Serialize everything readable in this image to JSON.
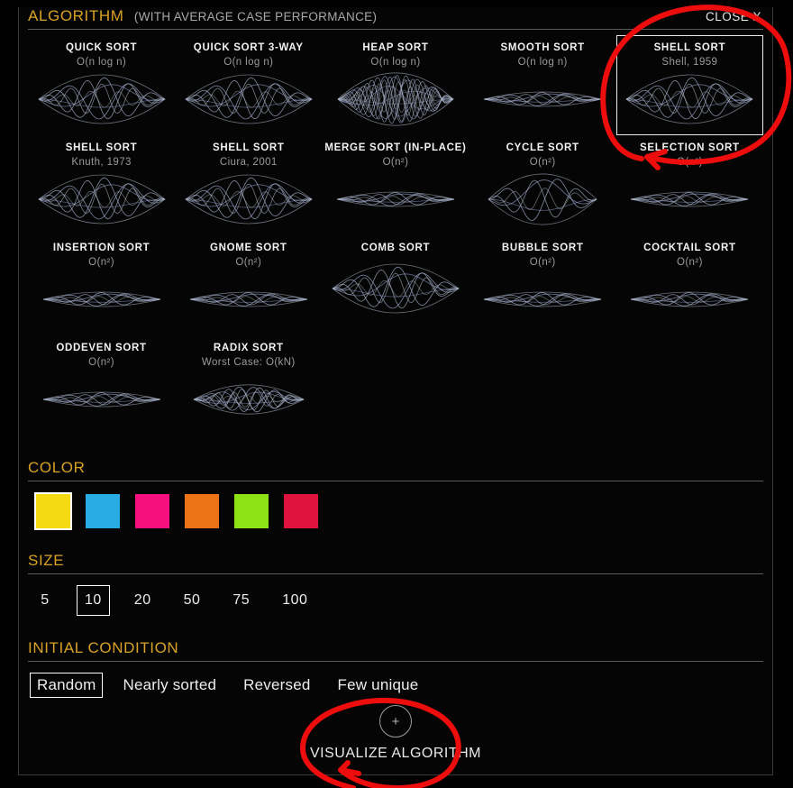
{
  "header": {
    "title": "ALGORITHM",
    "subtitle": "(WITH AVERAGE CASE PERFORMANCE)",
    "close_label": "CLOSE X"
  },
  "algorithms": [
    {
      "name": "QUICK SORT",
      "sub": "O(n log n)",
      "wave": "lens",
      "selected": false
    },
    {
      "name": "QUICK SORT 3-WAY",
      "sub": "O(n log n)",
      "wave": "lens",
      "selected": false
    },
    {
      "name": "HEAP SORT",
      "sub": "O(n log n)",
      "wave": "dense",
      "selected": false
    },
    {
      "name": "SMOOTH SORT",
      "sub": "O(n log n)",
      "wave": "flat",
      "selected": false
    },
    {
      "name": "SHELL SORT",
      "sub": "Shell, 1959",
      "wave": "lens",
      "selected": true
    },
    {
      "name": "SHELL SORT",
      "sub": "Knuth, 1973",
      "wave": "lens",
      "selected": false
    },
    {
      "name": "SHELL SORT",
      "sub": "Ciura, 2001",
      "wave": "lens",
      "selected": false
    },
    {
      "name": "MERGE SORT (IN-PLACE)",
      "sub": "O(n²)",
      "wave": "flat",
      "selected": false
    },
    {
      "name": "CYCLE SORT",
      "sub": "O(n²)",
      "wave": "bigeye",
      "selected": false
    },
    {
      "name": "SELECTION SORT",
      "sub": "O(n²)",
      "wave": "flat",
      "selected": false
    },
    {
      "name": "INSERTION SORT",
      "sub": "O(n²)",
      "wave": "flat",
      "selected": false
    },
    {
      "name": "GNOME SORT",
      "sub": "O(n²)",
      "wave": "flat",
      "selected": false
    },
    {
      "name": "COMB SORT",
      "sub": "",
      "wave": "lens",
      "selected": false
    },
    {
      "name": "BUBBLE SORT",
      "sub": "O(n²)",
      "wave": "flat",
      "selected": false
    },
    {
      "name": "COCKTAIL SORT",
      "sub": "O(n²)",
      "wave": "flat",
      "selected": false
    },
    {
      "name": "ODDEVEN SORT",
      "sub": "O(n²)",
      "wave": "flat",
      "selected": false
    },
    {
      "name": "RADIX SORT",
      "sub": "Worst Case: O(kN)",
      "wave": "radix",
      "selected": false
    }
  ],
  "color": {
    "title": "COLOR",
    "swatches": [
      {
        "name": "yellow",
        "hex": "#f5d913",
        "selected": true
      },
      {
        "name": "blue",
        "hex": "#29ace3",
        "selected": false
      },
      {
        "name": "magenta",
        "hex": "#f50f7f",
        "selected": false
      },
      {
        "name": "orange",
        "hex": "#ee7317",
        "selected": false
      },
      {
        "name": "green",
        "hex": "#8ce215",
        "selected": false
      },
      {
        "name": "crimson",
        "hex": "#e0133f",
        "selected": false
      }
    ]
  },
  "size": {
    "title": "SIZE",
    "options": [
      {
        "label": "5",
        "selected": false
      },
      {
        "label": "10",
        "selected": true
      },
      {
        "label": "20",
        "selected": false
      },
      {
        "label": "50",
        "selected": false
      },
      {
        "label": "75",
        "selected": false
      },
      {
        "label": "100",
        "selected": false
      }
    ]
  },
  "initial_condition": {
    "title": "INITIAL CONDITION",
    "options": [
      {
        "label": "Random",
        "selected": true
      },
      {
        "label": "Nearly sorted",
        "selected": false
      },
      {
        "label": "Reversed",
        "selected": false
      },
      {
        "label": "Few unique",
        "selected": false
      }
    ]
  },
  "visualize": {
    "icon": "plus-icon",
    "plus": "+",
    "label": "VISUALIZE ALGORITHM"
  },
  "annotations": {
    "accent": "#ee0d0d",
    "marks": [
      {
        "name": "circle-around-shell-sort"
      },
      {
        "name": "circle-around-visualize-algorithm"
      }
    ]
  }
}
